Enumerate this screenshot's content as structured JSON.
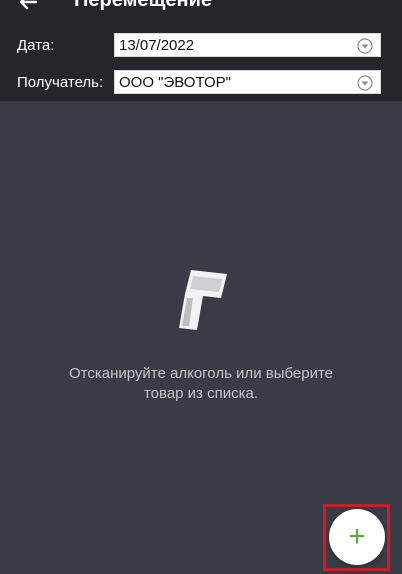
{
  "header": {
    "title": "Перемещение",
    "back_icon": "arrow-left-icon"
  },
  "form": {
    "date_label": "Дата:",
    "date_value": "13/07/2022",
    "recipient_label": "Получатель:",
    "recipient_value": "ООО \"ЭВОТОР\""
  },
  "empty_state": {
    "icon": "barcode-scanner-icon",
    "line1": "Отсканируйте алкоголь или выберите",
    "line2": "товар из списка."
  },
  "fab": {
    "label": "+",
    "icon": "plus-icon",
    "color": "#5cac35"
  },
  "colors": {
    "background": "#3b3b45",
    "header": "#25252b",
    "highlight": "#e0141e"
  }
}
